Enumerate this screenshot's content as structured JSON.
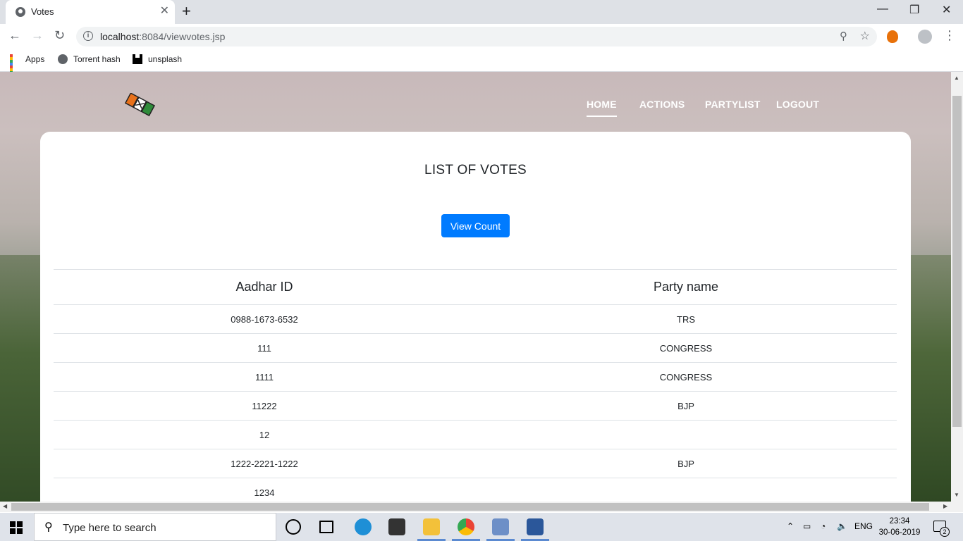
{
  "browser": {
    "tab_title": "Votes",
    "tab_close": "✕",
    "new_tab": "+",
    "url_host": "localhost",
    "url_rest": ":8084/viewvotes.jsp",
    "bookmarks": [
      "Apps",
      "Torrent hash",
      "unsplash"
    ]
  },
  "site": {
    "nav": [
      "HOME",
      "ACTIONS",
      "PARTYLIST",
      "LOGOUT"
    ],
    "active_nav": "HOME",
    "heading": "LIST OF VOTES",
    "button": "View Count",
    "table": {
      "headers": [
        "Aadhar ID",
        "Party name"
      ],
      "rows": [
        [
          "0988-1673-6532",
          "TRS"
        ],
        [
          "111",
          "CONGRESS"
        ],
        [
          "1111",
          "CONGRESS"
        ],
        [
          "11222",
          "BJP"
        ],
        [
          "12",
          ""
        ],
        [
          "1222-2221-1222",
          "BJP"
        ],
        [
          "1234",
          ""
        ]
      ]
    },
    "colors": {
      "button": "#007bff",
      "text": "#212529"
    }
  },
  "taskbar": {
    "search_placeholder": "Type here to search",
    "language": "ENG",
    "time": "23:34",
    "date": "30-06-2019",
    "notifications": "2"
  }
}
